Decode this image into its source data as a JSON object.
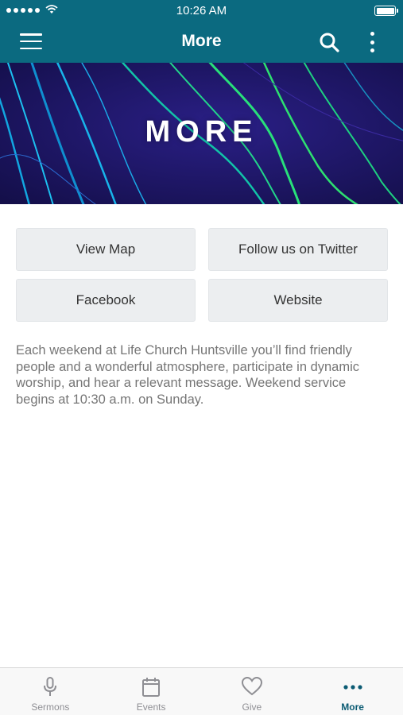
{
  "status_bar": {
    "time": "10:26 AM"
  },
  "nav": {
    "title": "More"
  },
  "hero": {
    "title": "MORE"
  },
  "buttons": [
    {
      "label": "View Map"
    },
    {
      "label": "Follow us on Twitter"
    },
    {
      "label": "Facebook"
    },
    {
      "label": "Website"
    }
  ],
  "description": "Each weekend at Life Church Huntsville you’ll find friendly people and a wonderful atmosphere, participate in dynamic worship, and hear a relevant message. Weekend service begins at 10:30 a.m. on Sunday.",
  "tabs": [
    {
      "label": "Sermons",
      "icon": "microphone-icon"
    },
    {
      "label": "Events",
      "icon": "calendar-icon"
    },
    {
      "label": "Give",
      "icon": "heart-icon"
    },
    {
      "label": "More",
      "icon": "more-dots-icon",
      "active": true
    }
  ],
  "colors": {
    "header": "#0b6a80",
    "active_tab": "#0b5b73",
    "tile": "#eceef0"
  }
}
